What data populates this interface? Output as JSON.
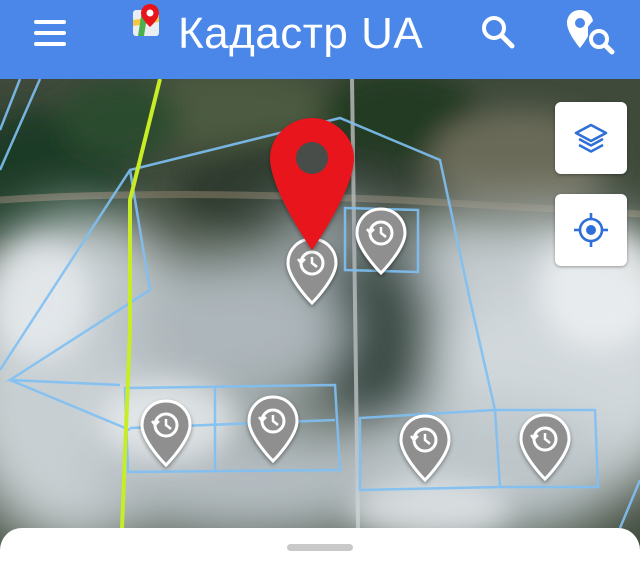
{
  "app_bar": {
    "title": "Кадастр UA",
    "background": "#4a87e8",
    "menu_icon": "menu-icon",
    "logo_icon": "map-logo-icon",
    "search_icon": "search-icon",
    "locate_search_icon": "map-pin-search-icon"
  },
  "map": {
    "selected_marker_color": "#e8141c",
    "history_marker_color": "#8f8f8f",
    "parcel_outline_color": "#7fc0f4",
    "boundary_line_color": "#c8ec26",
    "history_marker_count": 6
  },
  "controls": {
    "layers_icon": "layers-icon",
    "my_location_icon": "crosshair-icon",
    "accent": "#2f6fd8"
  },
  "bottom_sheet": {
    "handle": "drag-handle"
  }
}
